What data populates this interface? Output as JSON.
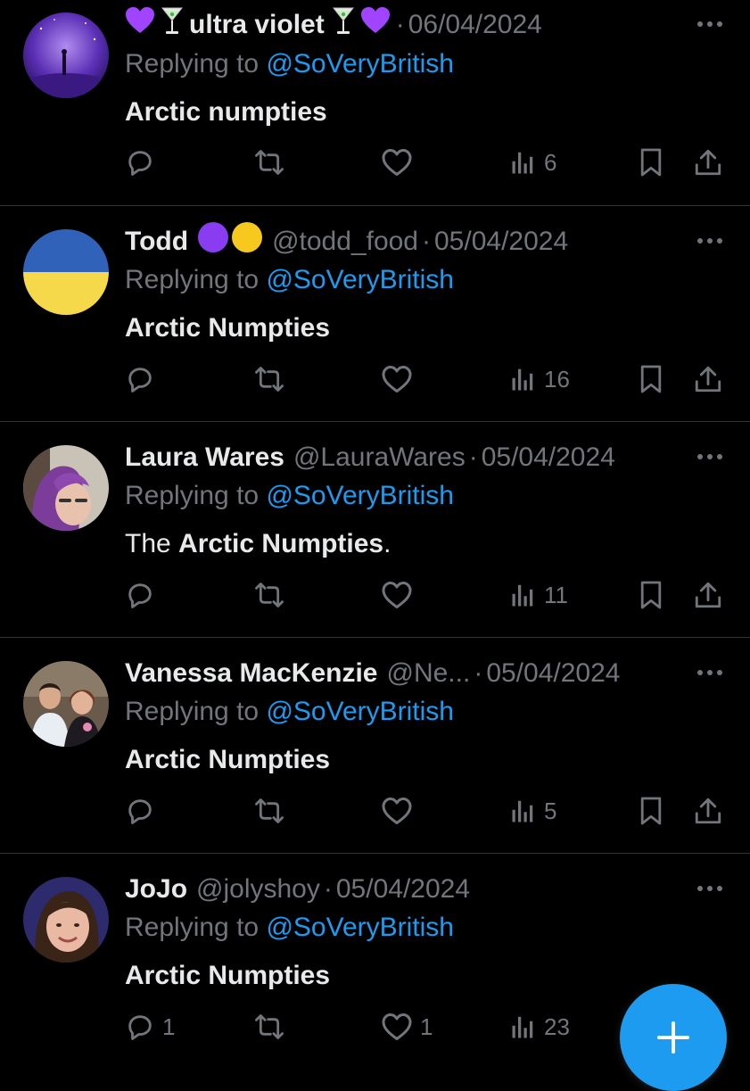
{
  "colors": {
    "background": "#000000",
    "primary_text": "#e7e9ea",
    "secondary_text": "#71767b",
    "link": "#1d9bf0",
    "divider": "#2f3336",
    "fab": "#1d9bf0"
  },
  "reply_prefix": "Replying to",
  "tweets": [
    {
      "display_name": "ultra violet",
      "name_emojis": [
        "purple-heart",
        "cocktail-glass",
        "cocktail-glass",
        "purple-heart"
      ],
      "handle": "",
      "separator": "·",
      "date": "06/04/2024",
      "replying_to": "@SoVeryBritish",
      "text_pre": "",
      "text_bold": "Arctic numpties",
      "text_post": "",
      "replies": "",
      "likes": "",
      "views": "6",
      "avatar": "purple-night-silhouette"
    },
    {
      "display_name": "Todd",
      "name_emojis": [
        "purple-circle",
        "yellow-circle"
      ],
      "handle": "@todd_food",
      "separator": "·",
      "date": "05/04/2024",
      "replying_to": "@SoVeryBritish",
      "text_pre": "",
      "text_bold": "Arctic Numpties",
      "text_post": "",
      "replies": "",
      "likes": "",
      "views": "16",
      "avatar": "ukraine-flag-circle"
    },
    {
      "display_name": "Laura Wares",
      "name_emojis": [],
      "handle": "@LauraWares",
      "separator": "·",
      "date": "05/04/2024",
      "replying_to": "@SoVeryBritish",
      "text_pre": "The ",
      "text_bold": "Arctic Numpties",
      "text_post": ".",
      "replies": "",
      "likes": "",
      "views": "11",
      "avatar": "purple-hair-portrait"
    },
    {
      "display_name": "Vanessa MacKenzie",
      "name_emojis": [],
      "handle": "@Ne...",
      "separator": "·",
      "date": "05/04/2024",
      "replying_to": "@SoVeryBritish",
      "text_pre": "",
      "text_bold": "Arctic Numpties",
      "text_post": "",
      "replies": "",
      "likes": "",
      "views": "5",
      "avatar": "couple-photo"
    },
    {
      "display_name": "JoJo",
      "name_emojis": [],
      "handle": "@jolyshoy",
      "separator": "·",
      "date": "05/04/2024",
      "replying_to": "@SoVeryBritish",
      "text_pre": "",
      "text_bold": "Arctic Numpties",
      "text_post": "",
      "replies": "1",
      "likes": "1",
      "views": "23",
      "avatar": "smiling-woman-portrait"
    }
  ],
  "icons": {
    "more": "more-dots-icon",
    "reply": "reply-icon",
    "retweet": "retweet-icon",
    "like": "heart-icon",
    "views": "views-icon",
    "bookmark": "bookmark-icon",
    "share": "share-icon",
    "compose": "plus-icon"
  }
}
